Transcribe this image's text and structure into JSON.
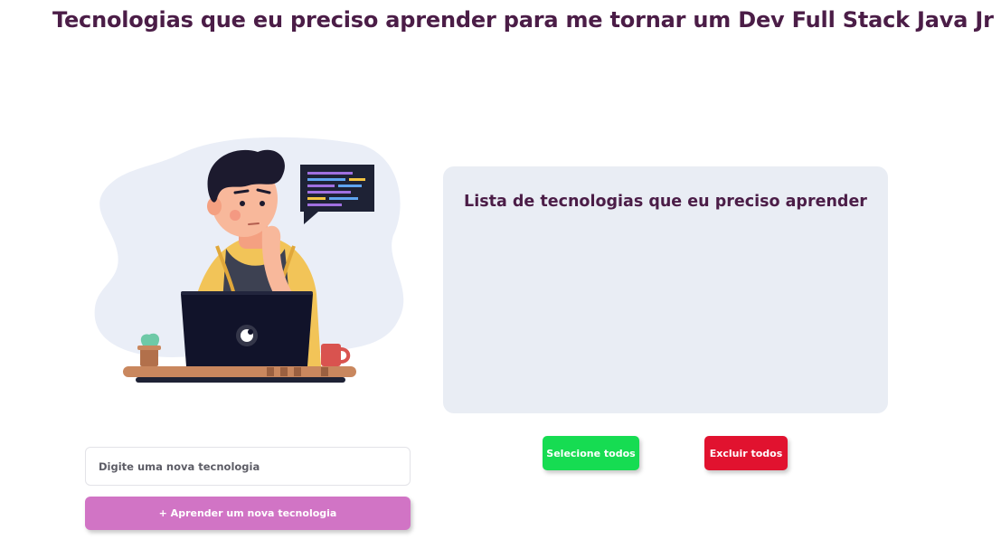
{
  "header": {
    "title": "Tecnologias que eu preciso aprender para me tornar um Dev Full Stack Java Jr"
  },
  "illustration": {
    "icon": "developer-thinking-illustration"
  },
  "list_panel": {
    "title": "Lista de tecnologias que eu preciso aprender",
    "items": []
  },
  "actions": {
    "select_all_label": "Selecione todos",
    "delete_all_label": "Excluir todos"
  },
  "form": {
    "input_value": "",
    "input_placeholder": "Digite uma nova tecnologia",
    "add_label": "+ Aprender um nova tecnologia"
  },
  "colors": {
    "title": "#4b1d47",
    "panel_bg": "#e9edf4",
    "select_button": "#16dc52",
    "delete_button": "#e1122f",
    "add_button": "#d174c5"
  }
}
